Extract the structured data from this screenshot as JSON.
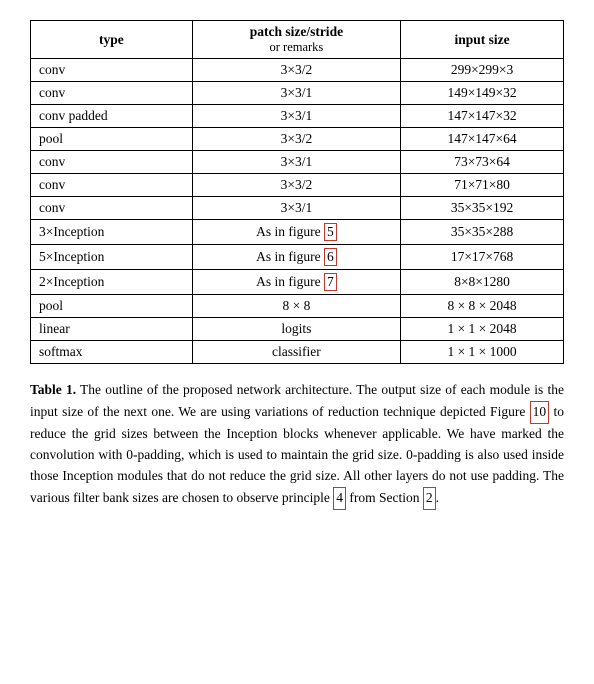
{
  "table": {
    "headers": {
      "col1": "type",
      "col2_main": "patch size/stride",
      "col2_sub": "or remarks",
      "col3": "input size"
    },
    "rows": [
      {
        "type": "conv",
        "patch": "3×3/2",
        "input": "299×299×3"
      },
      {
        "type": "conv",
        "patch": "3×3/1",
        "input": "149×149×32"
      },
      {
        "type": "conv padded",
        "patch": "3×3/1",
        "input": "147×147×32"
      },
      {
        "type": "pool",
        "patch": "3×3/2",
        "input": "147×147×64"
      },
      {
        "type": "conv",
        "patch": "3×3/1",
        "input": "73×73×64"
      },
      {
        "type": "conv",
        "patch": "3×3/2",
        "input": "71×71×80"
      },
      {
        "type": "conv",
        "patch": "3×3/1",
        "input": "35×35×192"
      },
      {
        "type": "3×Inception",
        "patch": "As in figure 5",
        "input": "35×35×288",
        "highlight": "5"
      },
      {
        "type": "5×Inception",
        "patch": "As in figure 6",
        "input": "17×17×768",
        "highlight": "6"
      },
      {
        "type": "2×Inception",
        "patch": "As in figure 7",
        "input": "8×8×1280",
        "highlight": "7"
      },
      {
        "type": "pool",
        "patch": "8 × 8",
        "input": "8 × 8 × 2048"
      },
      {
        "type": "linear",
        "patch": "logits",
        "input": "1 × 1 × 2048"
      },
      {
        "type": "softmax",
        "patch": "classifier",
        "input": "1 × 1 × 1000"
      }
    ]
  },
  "caption": {
    "label": "Table 1.",
    "text": " The outline of the proposed network architecture.  The output size of each module is the input size of the next one.  We are using variations of reduction technique depicted Figure ",
    "ref1": "10",
    "text2": " to reduce the grid sizes between the Inception blocks whenever applicable. We have marked the convolution with 0-padding, which is used to maintain the grid size.  0-padding is also used inside those Inception modules that do not reduce the grid size. All other layers do not use padding. The various filter bank sizes are chosen to observe principle ",
    "ref2": "4",
    "text3": " from Section ",
    "ref3": "2",
    "text4": "."
  }
}
